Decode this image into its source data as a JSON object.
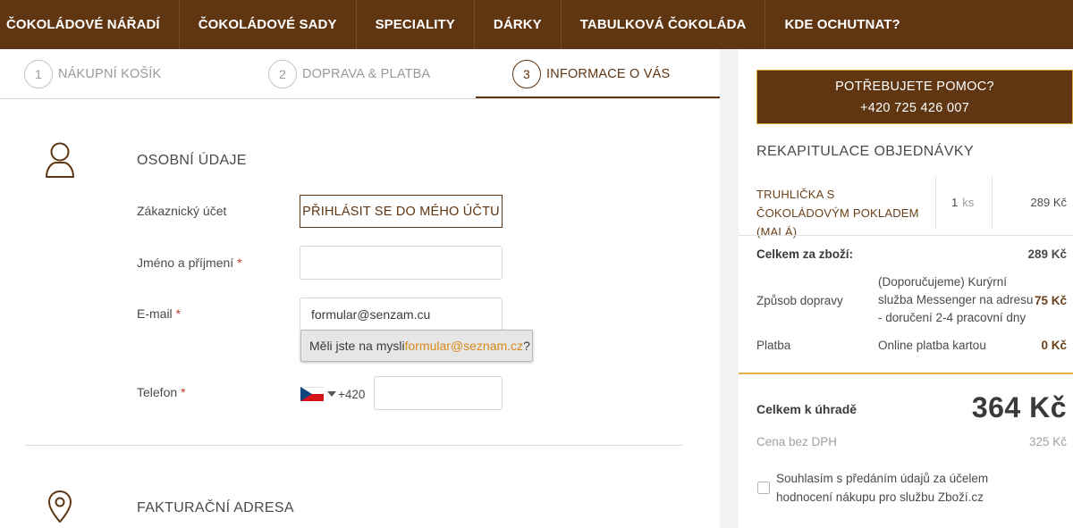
{
  "nav": {
    "items": [
      "ČOKOLÁDOVÉ NÁŘADÍ",
      "ČOKOLÁDOVÉ SADY",
      "SPECIALITY",
      "DÁRKY",
      "TABULKOVÁ ČOKOLÁDA",
      "KDE OCHUTNAT?"
    ]
  },
  "steps": [
    {
      "num": "1",
      "label": "NÁKUPNÍ KOŠÍK"
    },
    {
      "num": "2",
      "label": "DOPRAVA & PLATBA"
    },
    {
      "num": "3",
      "label": "INFORMACE O VÁS",
      "active": true
    }
  ],
  "personal": {
    "title": "OSOBNÍ ÚDAJE",
    "account_label": "Zákaznický účet",
    "login_button": "PŘIHLÁSIT SE DO MÉHO ÚČTU",
    "name_label": "Jméno a příjmení",
    "name_value": "",
    "email_label": "E-mail",
    "email_value": "formular@senzam.cu",
    "suggest_prefix": "Měli jste na mysli ",
    "suggest_email": "formular@seznam.cz",
    "suggest_suffix": "?",
    "phone_label": "Telefon",
    "phone_prefix": "+420",
    "phone_value": "",
    "required_mark": "*"
  },
  "billing": {
    "title": "FAKTURAČNÍ ADRESA"
  },
  "help": {
    "line1": "POTŘEBUJETE POMOC?",
    "line2": "+420 725 426 007"
  },
  "recap": {
    "title": "REKAPITULACE OBJEDNÁVKY",
    "item": {
      "name": "TRUHLIČKA S ČOKOLÁDOVÝM POKLADEM (MALÁ)",
      "qty": "1",
      "unit": "ks",
      "price": "289 Kč"
    },
    "goods_total_label": "Celkem za zboží:",
    "goods_total_value": "289 Kč",
    "delivery_label": "Způsob dopravy",
    "delivery_desc": "(Doporučujeme) Kurýrní služba Messenger na adresu - doručení 2-4 pracovní dny",
    "delivery_price": "75 Kč",
    "payment_label": "Platba",
    "payment_desc": "Online platba kartou",
    "payment_price": "0 Kč",
    "total_label": "Celkem k úhradě",
    "total_value": "364 Kč",
    "novat_label": "Cena bez DPH",
    "novat_value": "325 Kč",
    "consent_text": "Souhlasím s předáním údajů za účelem hodnocení nákupu pro službu Zboží.cz"
  }
}
